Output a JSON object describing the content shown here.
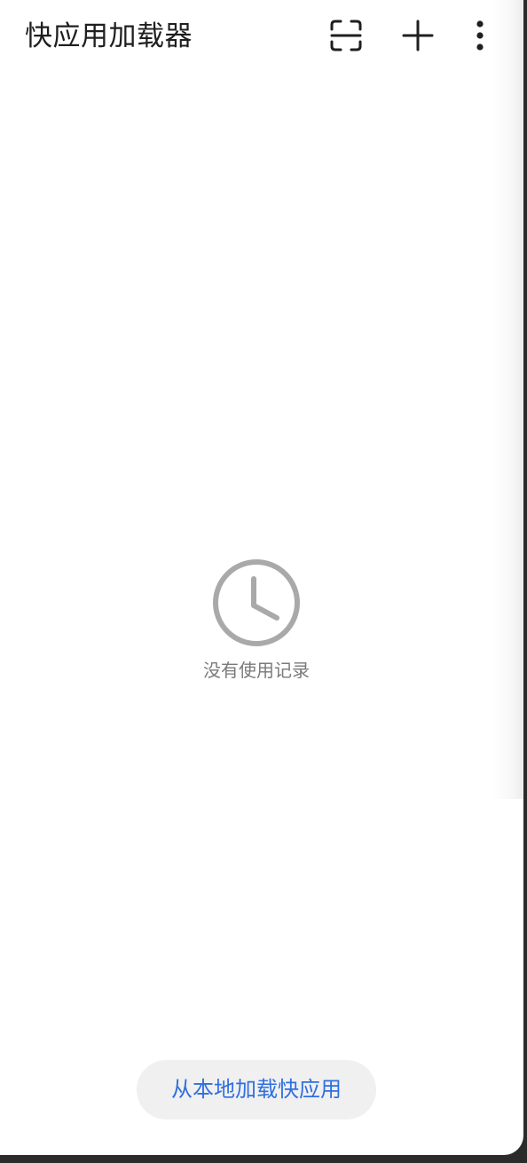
{
  "header": {
    "title": "快应用加载器",
    "actions": [
      {
        "name": "scan",
        "icon": "scan-icon"
      },
      {
        "name": "add",
        "icon": "plus-icon"
      },
      {
        "name": "more",
        "icon": "more-vertical-icon"
      }
    ]
  },
  "empty_state": {
    "icon": "clock-icon",
    "message": "没有使用记录"
  },
  "footer": {
    "load_local_label": "从本地加载快应用"
  },
  "colors": {
    "background": "#ffffff",
    "title_text": "#1f1f1f",
    "muted_text": "#7a7a7a",
    "icon_gray": "#a9a9a9",
    "accent_blue": "#2f6fe0",
    "button_bg": "#f0f0f0"
  }
}
